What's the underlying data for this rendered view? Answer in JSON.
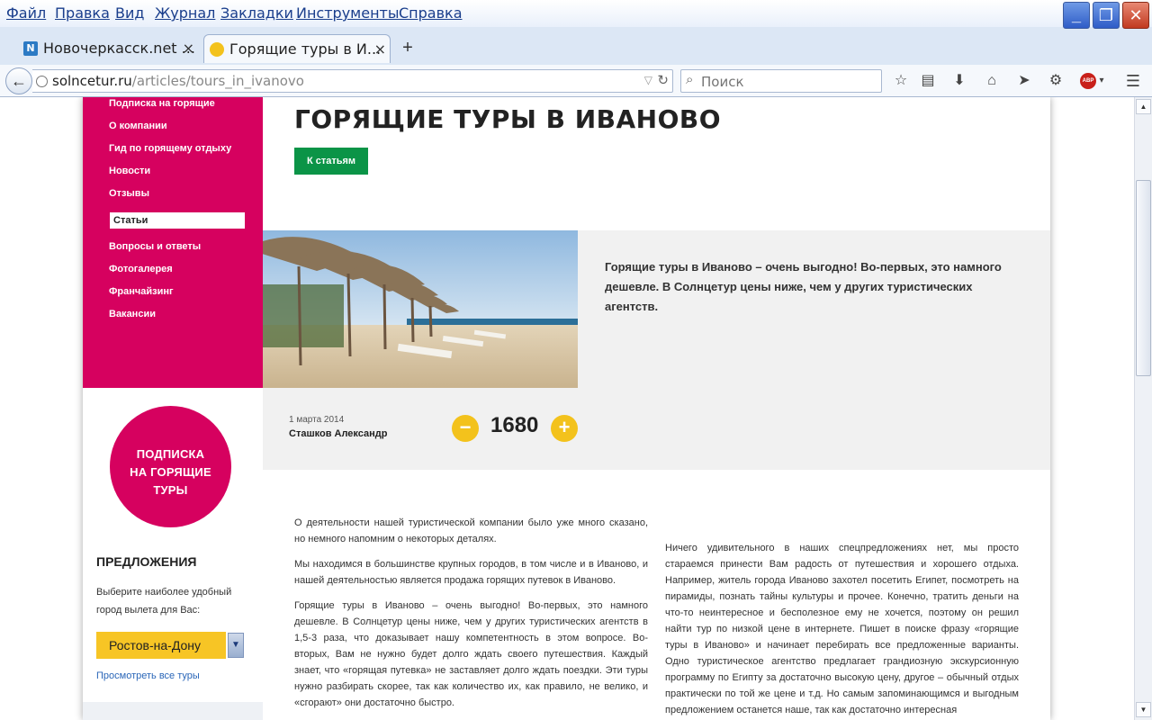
{
  "browser": {
    "menu": [
      "Файл",
      "Правка",
      "Вид",
      "Журнал",
      "Закладки",
      "Инструменты",
      "Справка"
    ],
    "tabs": [
      {
        "title": "Новочеркасск.net ..."
      },
      {
        "title": "Горящие туры в И..."
      }
    ],
    "url": {
      "domain": "solncetur.ru",
      "path": "/articles/tours_in_ivanovo"
    },
    "search_placeholder": "Поиск",
    "abp_label": "ABP"
  },
  "sidebar": {
    "nav": [
      {
        "label": "Подписка на горящие"
      },
      {
        "label": "О компании"
      },
      {
        "label": "Гид по горящему отдыху"
      },
      {
        "label": "Новости"
      },
      {
        "label": "Отзывы"
      },
      {
        "label": "Статьи",
        "active": true
      },
      {
        "label": "Вопросы и ответы"
      },
      {
        "label": "Фотогалерея"
      },
      {
        "label": "Франчайзинг"
      },
      {
        "label": "Вакансии"
      }
    ],
    "promo": {
      "line1": "ПОДПИСКА",
      "line2": "НА ГОРЯЩИЕ",
      "line3": "ТУРЫ"
    },
    "offers_title": "ПРЕДЛОЖЕНИЯ",
    "offers_desc": "Выберите наиболее удобный город вылета для Вас:",
    "city_selected": "Ростов-на-Дону",
    "all_tours_link": "Просмотреть все туры"
  },
  "article": {
    "title": "ГОРЯЩИЕ ТУРЫ В ИВАНОВО",
    "back_button": "К статьям",
    "lead": "Горящие туры в Иваново – очень выгодно! Во-первых, это намного дешевле. В Солнцетур цены ниже, чем у других туристических агентств.",
    "date": "1 марта 2014",
    "author": "Сташков Александр",
    "votes": "1680",
    "minus": "−",
    "plus": "+",
    "col_left": [
      "О деятельности нашей туристической компании было уже много сказано, но немного напомним о некоторых деталях.",
      "Мы находимся в большинстве крупных городов, в том числе и в Иваново, и нашей деятельностью является продажа горящих путевок в Иваново.",
      "Горящие туры в Иваново – очень выгодно! Во-первых, это намного дешевле. В Солнцетур цены ниже, чем у других туристических агентств в 1,5-3 раза, что доказывает нашу компетентность в этом вопросе. Во-вторых, Вам не нужно будет долго ждать своего путешествия. Каждый знает, что «горящая путевка» не заставляет долго ждать поездки. Эти туры нужно разбирать скорее, так как количество их, как правило, не велико, и «сгорают» они достаточно быстро."
    ],
    "col_right": "Ничего удивительного в наших спецпредложениях нет, мы просто стараемся принести Вам радость от путешествия и хорошего отдыха. Например, житель города Иваново захотел посетить Египет, посмотреть на пирамиды, познать тайны культуры и прочее. Конечно, тратить деньги на что-то неинтересное и бесполезное ему не хочется, поэтому он решил найти тур по низкой цене в интернете. Пишет в поиске фразу «горящие туры в Иваново» и начинает перебирать все предложенные варианты. Одно туристическое агентство предлагает грандиозную экскурсионную программу по Египту за достаточно высокую цену, другое – обычный отдых практически по той же цене и т.д. Но самым запоминающимся и выгодным предложением останется наше, так как достаточно интересная"
  },
  "colors": {
    "brand_magenta": "#d6015f",
    "button_green": "#0b9447",
    "accent_yellow": "#f3c21c"
  }
}
